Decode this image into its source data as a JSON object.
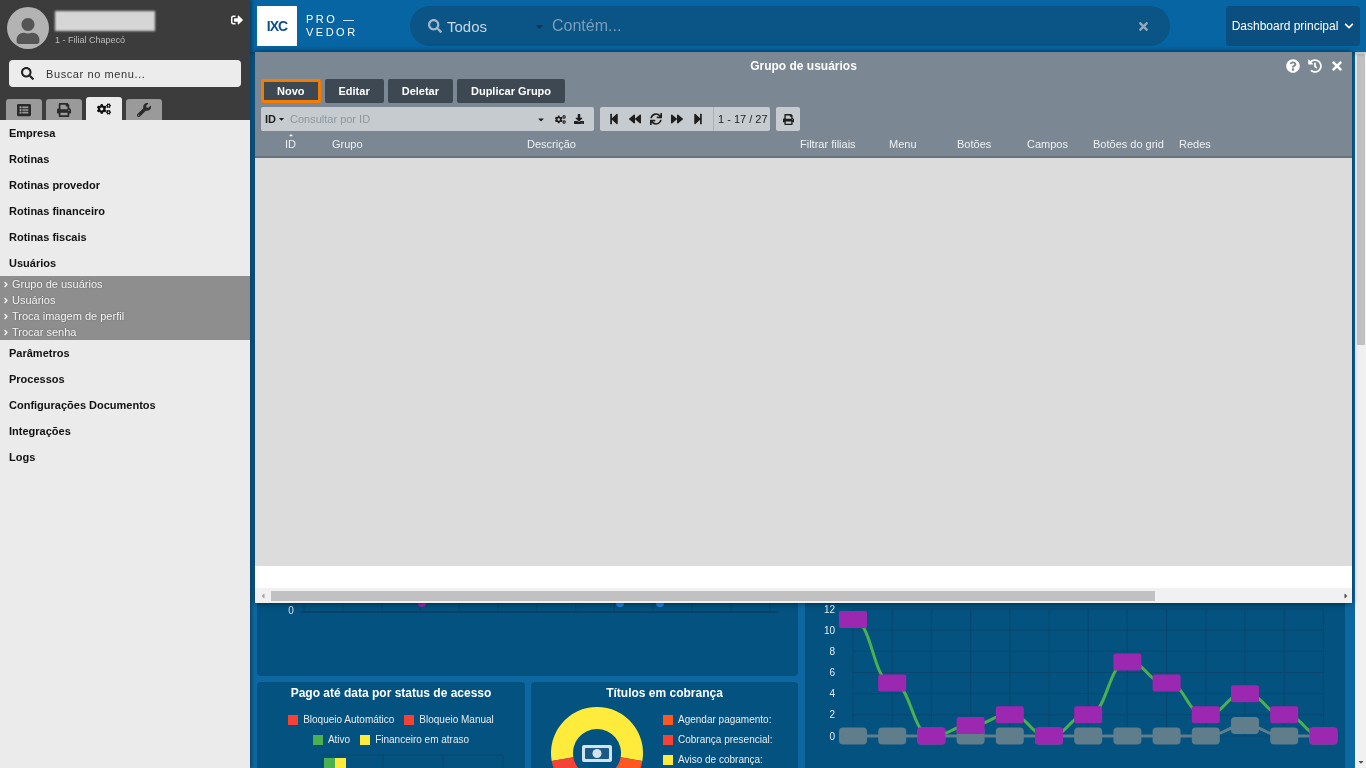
{
  "sidebar": {
    "user": {
      "branch": "1 - Filial Chapecó"
    },
    "search": {
      "placeholder": "Buscar no menu..."
    },
    "tabs": [
      {
        "kind": "list",
        "selected": false
      },
      {
        "kind": "print",
        "selected": false
      },
      {
        "kind": "gears",
        "selected": true
      },
      {
        "kind": "wrench",
        "selected": false
      }
    ],
    "menu": [
      {
        "label": "Empresa"
      },
      {
        "label": "Rotinas"
      },
      {
        "label": "Rotinas provedor"
      },
      {
        "label": "Rotinas financeiro"
      },
      {
        "label": "Rotinas fiscais"
      },
      {
        "label": "Usuários",
        "children": [
          {
            "label": "Grupo de usuários"
          },
          {
            "label": "Usuários"
          },
          {
            "label": "Troca imagem de perfil"
          },
          {
            "label": "Trocar senha"
          }
        ]
      },
      {
        "label": "Parâmetros"
      },
      {
        "label": "Processos"
      },
      {
        "label": "Configurações Documentos"
      },
      {
        "label": "Integrações"
      },
      {
        "label": "Logs"
      }
    ]
  },
  "topbar": {
    "logo": {
      "mark": "IXC",
      "line_1": "PRO —",
      "line_2": "VEDOR"
    },
    "search": {
      "scope": "Todos",
      "placeholder": "Contém..."
    },
    "dashboard_menu": {
      "label": "Dashboard principal"
    }
  },
  "window": {
    "title": "Grupo de usuários",
    "buttons": [
      {
        "label": "Novo",
        "focused": true
      },
      {
        "label": "Editar",
        "focused": false
      },
      {
        "label": "Deletar",
        "focused": false
      },
      {
        "label": "Duplicar Grupo",
        "focused": false
      }
    ],
    "filter": {
      "field": "ID",
      "placeholder": "Consultar por ID"
    },
    "pager": {
      "range": "1 - 17 / 27"
    },
    "columns": [
      {
        "label": "ID",
        "sorted": true
      },
      {
        "label": "Grupo",
        "sorted": false
      },
      {
        "label": "Descrição",
        "sorted": false
      },
      {
        "label": "Filtrar filiais",
        "sorted": false
      },
      {
        "label": "Menu",
        "sorted": false
      },
      {
        "label": "Botões",
        "sorted": false
      },
      {
        "label": "Campos",
        "sorted": false
      },
      {
        "label": "Botões do grid",
        "sorted": false
      },
      {
        "label": "Redes",
        "sorted": false
      }
    ]
  },
  "dashboard": {
    "activity_panel": {
      "y_tick": "0"
    },
    "trend_panel": {
      "chart_data": {
        "type": "line",
        "grid": true,
        "ylim": [
          0,
          12
        ],
        "yticks": [
          0,
          2,
          4,
          6,
          8,
          10,
          12
        ],
        "series": [
          {
            "color": "#4caf50",
            "marker": "square",
            "values": [
              11,
              5,
              0,
              1,
              2,
              0,
              2,
              7,
              5,
              2,
              4,
              2,
              0
            ]
          },
          {
            "color": "#607d8b",
            "marker": "square",
            "values": [
              0,
              0,
              0,
              0,
              0,
              0,
              0,
              0,
              0,
              0,
              1,
              0,
              0
            ]
          }
        ]
      }
    },
    "paid_panel": {
      "title": "Pago até data por status de acesso",
      "legend": [
        {
          "label": "Bloqueio Automático",
          "color": "#f44336"
        },
        {
          "label": "Bloqueio Manual",
          "color": "#f44336"
        },
        {
          "label": "Ativo",
          "color": "#4caf50"
        },
        {
          "label": "Financeiro em atraso",
          "color": "#ffeb3b"
        }
      ]
    },
    "billing_panel": {
      "title": "Títulos em cobrança",
      "legend": [
        {
          "label": "Agendar pagamento:",
          "color": "#ff5722"
        },
        {
          "label": "Cobrança presencial:",
          "color": "#f44336"
        },
        {
          "label": "Aviso de cobrança:",
          "color": "#ffeb3b"
        }
      ]
    }
  }
}
